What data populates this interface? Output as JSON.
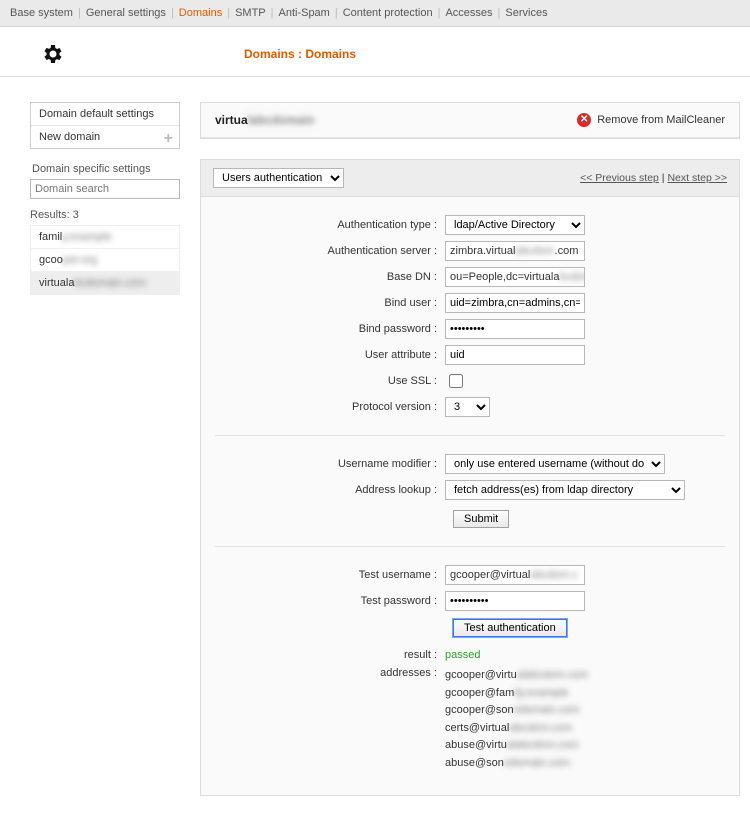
{
  "nav": {
    "items": [
      "Base system",
      "General settings",
      "Domains",
      "SMTP",
      "Anti-Spam",
      "Content protection",
      "Accesses",
      "Services"
    ],
    "activeIndex": 2
  },
  "breadcrumb": "Domains : Domains",
  "sidebar": {
    "default_settings": "Domain default settings",
    "new_domain": "New domain",
    "specific_heading": "Domain specific settings",
    "search_placeholder": "Domain search",
    "results_label": "Results: 3",
    "results": [
      {
        "vis": "famil",
        "hid": "y.example"
      },
      {
        "vis": "gcoo",
        "hid": "per.org"
      },
      {
        "vis": "virtuala",
        "hid": "bcdomain.com"
      }
    ],
    "selected": 2
  },
  "domain": {
    "title_vis": "virtua",
    "title_hid": "labcdomain",
    "remove_label": "Remove from MailCleaner"
  },
  "tabs": {
    "current": "Users authentication",
    "prev": "<< Previous step",
    "next": "Next step >>"
  },
  "form": {
    "auth_type_label": "Authentication type :",
    "auth_type_value": "ldap/Active Directory",
    "auth_server_label": "Authentication server :",
    "auth_server_vis": "zimbra.virtual",
    "auth_server_hid": "abcdom",
    "auth_server_suf": ".com",
    "base_dn_label": "Base DN :",
    "base_dn_vis": "ou=People,dc=virtuala",
    "base_dn_hid": "bcdom",
    "bind_user_label": "Bind user :",
    "bind_user_value": "uid=zimbra,cn=admins,cn=z",
    "bind_pw_label": "Bind password :",
    "bind_pw_value": "•••••••••",
    "user_attr_label": "User attribute :",
    "user_attr_value": "uid",
    "use_ssl_label": "Use SSL :",
    "proto_label": "Protocol version :",
    "proto_value": "3",
    "user_mod_label": "Username modifier :",
    "user_mod_value": "only use entered username (without domain)",
    "addr_lookup_label": "Address lookup :",
    "addr_lookup_value": "fetch address(es) from ldap directory",
    "submit": "Submit",
    "test_user_label": "Test username :",
    "test_user_vis": "gcooper@virtual",
    "test_user_hid": "abcdom.c",
    "test_pw_label": "Test password :",
    "test_pw_value": "••••••••••",
    "test_btn": "Test authentication",
    "result_label": "result :",
    "result_value": "passed",
    "addresses_label": "addresses :",
    "addresses": [
      {
        "vis": "gcooper@virtu",
        "hid": "alabcdom.com"
      },
      {
        "vis": "gcooper@fam",
        "hid": "ily.example"
      },
      {
        "vis": "gcooper@son",
        "hid": "odomain.com"
      },
      {
        "vis": "certs@virtual",
        "hid": "abcdom.com"
      },
      {
        "vis": "abuse@virtu",
        "hid": "alabcdom.com"
      },
      {
        "vis": "abuse@son",
        "hid": "odomain.com"
      }
    ]
  }
}
